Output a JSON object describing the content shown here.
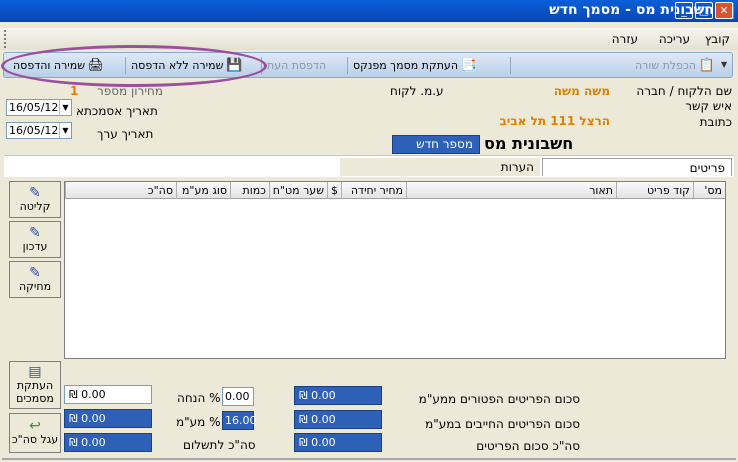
{
  "window": {
    "title": "חשבונית מס  -  מסמך חדש",
    "buttons": {
      "close": "✕",
      "maximize": "□",
      "minimize": "_"
    }
  },
  "menu": {
    "file": "קובץ",
    "edit": "עריכה",
    "help": "עזרה"
  },
  "toolbar": {
    "duplicate_row": "הכפלת שורה",
    "copy_from_ledger": "העתקת מסמך מפנקס",
    "print_copy": "הדפסת העת",
    "save_no_print": "שמירה ללא הדפסה",
    "save_and_print": "שמירה והדפסה"
  },
  "header": {
    "customer_name_label": "שם הלקוח / חברה",
    "customer_name_value": "משה משה",
    "contact_label": "איש קשר",
    "address_label": "כתובת",
    "address_value": "הרצל 111 תל אביב",
    "customer_id_label": "ע.מ. לקוח",
    "price_list_label": "מחירון מספר",
    "price_list_value": "1",
    "reference_date_label": "תאריך אסמכתא",
    "reference_date_value": "16/05/12",
    "value_date_label": "תאריך ערך",
    "value_date_value": "16/05/12",
    "doc_title": "חשבונית מס",
    "doc_number": "מספר חדש"
  },
  "tabs": {
    "items": "פריטים",
    "notes": "הערות"
  },
  "grid": {
    "columns": {
      "row_no": "מס'",
      "item_code": "קוד פריט",
      "description": "תאור",
      "unit_price": "מחיר יחידה",
      "currency": "$",
      "rate": "שער מט\"ח",
      "quantity": "כמות",
      "vat_type": "סוג מע\"מ",
      "total": "סה\"כ"
    }
  },
  "side_buttons": {
    "receive": "קליטה",
    "update": "עדכון",
    "delete": "מחיקה",
    "copy_docs": "העתקת מסמכים",
    "round_total": "עגל סה\"כ"
  },
  "totals": {
    "exempt_label": "סכום הפריטים הפטורים ממע\"מ",
    "exempt_value": "₪ 0.00",
    "taxable_label": "סכום הפריטים החייבים במע\"מ",
    "taxable_value": "₪ 0.00",
    "items_total_label": "סה\"כ סכום הפריטים",
    "items_total_value": "₪ 0.00",
    "discount_label": "% הנחה",
    "discount_pct": "0.00",
    "vat_label": "% מע\"מ",
    "vat_pct": "16.00",
    "to_pay_label": "סה\"כ לתשלום",
    "discount_amount": "₪ 0.00",
    "vat_amount": "₪ 0.00",
    "to_pay_amount": "₪ 0.00"
  },
  "colors": {
    "title_bar": "#0a5fd8",
    "field_blue": "#2d60b6",
    "highlight_oval": "#9a4f9f",
    "customer_value": "#e08000"
  }
}
